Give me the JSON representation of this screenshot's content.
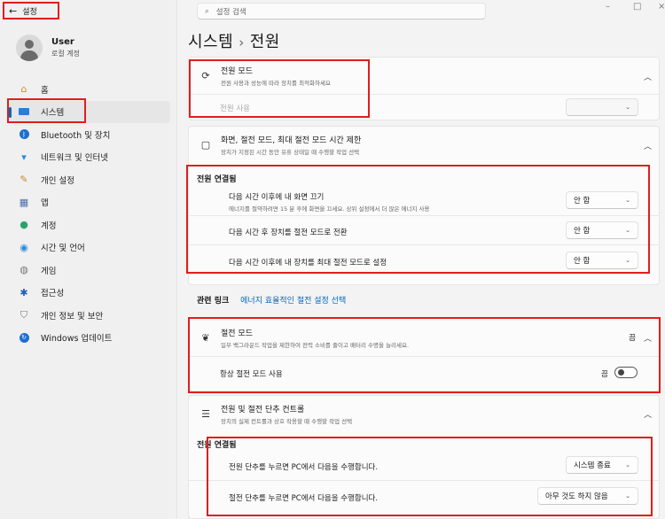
{
  "back": {
    "label": "설정"
  },
  "search": {
    "placeholder": "설정 검색"
  },
  "user": {
    "name": "User",
    "account": "로컬 계정"
  },
  "nav": [
    {
      "label": "홈",
      "icon": "home-icon"
    },
    {
      "label": "시스템",
      "icon": "system-icon"
    },
    {
      "label": "Bluetooth 및 장치",
      "icon": "bluetooth-icon"
    },
    {
      "label": "네트워크 및 인터넷",
      "icon": "network-icon"
    },
    {
      "label": "개인 설정",
      "icon": "brush-icon"
    },
    {
      "label": "앱",
      "icon": "apps-icon"
    },
    {
      "label": "계정",
      "icon": "account-icon"
    },
    {
      "label": "시간 및 언어",
      "icon": "globe-icon"
    },
    {
      "label": "게임",
      "icon": "gamepad-icon"
    },
    {
      "label": "접근성",
      "icon": "accessibility-icon"
    },
    {
      "label": "개인 정보 및 보안",
      "icon": "shield-icon"
    },
    {
      "label": "Windows 업데이트",
      "icon": "update-icon"
    }
  ],
  "breadcrumb": {
    "parent": "시스템",
    "sep": "›",
    "current": "전원"
  },
  "power_mode": {
    "title": "전원 모드",
    "desc": "전원 사용과 성능에 따라 장치를 최적화하세요",
    "row_label": "전원 사용"
  },
  "screen_sleep": {
    "title": "화면, 절전 모드, 최대 절전 모드 시간 제한",
    "desc": "장치가 지정된 시간 동안 유휴 상태일 때 수행할 작업 선택",
    "heading": "전원 연결됨",
    "rows": [
      {
        "label": "다음 시간 이후에 내 화면 끄기",
        "sub": "에너지를 절약하려면 15 분 후에 화면을 끄세요. 상위 설정에서 더 많은 에너지 사용",
        "value": "안 함"
      },
      {
        "label": "다음 시간 후 장치를 절전 모드로 전환",
        "value": "안 함"
      },
      {
        "label": "다음 시간 이후에 내 장치를 최대 절전 모드로 설정",
        "value": "안 함"
      }
    ]
  },
  "related": {
    "label": "관련 링크",
    "link": "에너지 효율적인 절전 설정 선택"
  },
  "energy_saver": {
    "title": "절전 모드",
    "desc": "일부 백그라운드 작업을 제한하여 전력 소비를 줄이고 배터리 수명을 늘리세요.",
    "state": "끔",
    "row_label": "항상 절전 모드 사용",
    "row_state": "끔"
  },
  "buttons": {
    "title": "전원 및 절전 단추 컨트롤",
    "desc": "장치의 실제 컨트롤과 상호 작용할 때 수행할 작업 선택",
    "heading": "전원 연결됨",
    "rows": [
      {
        "label": "전원 단추를 누르면 PC에서 다음을 수행합니다.",
        "value": "시스템 종료"
      },
      {
        "label": "절전 단추를 누르면 PC에서 다음을 수행합니다.",
        "value": "아무 것도 하지 않음"
      }
    ]
  },
  "colors": {
    "accent": "#0067c0",
    "highlight_box": "#e11d1d"
  }
}
